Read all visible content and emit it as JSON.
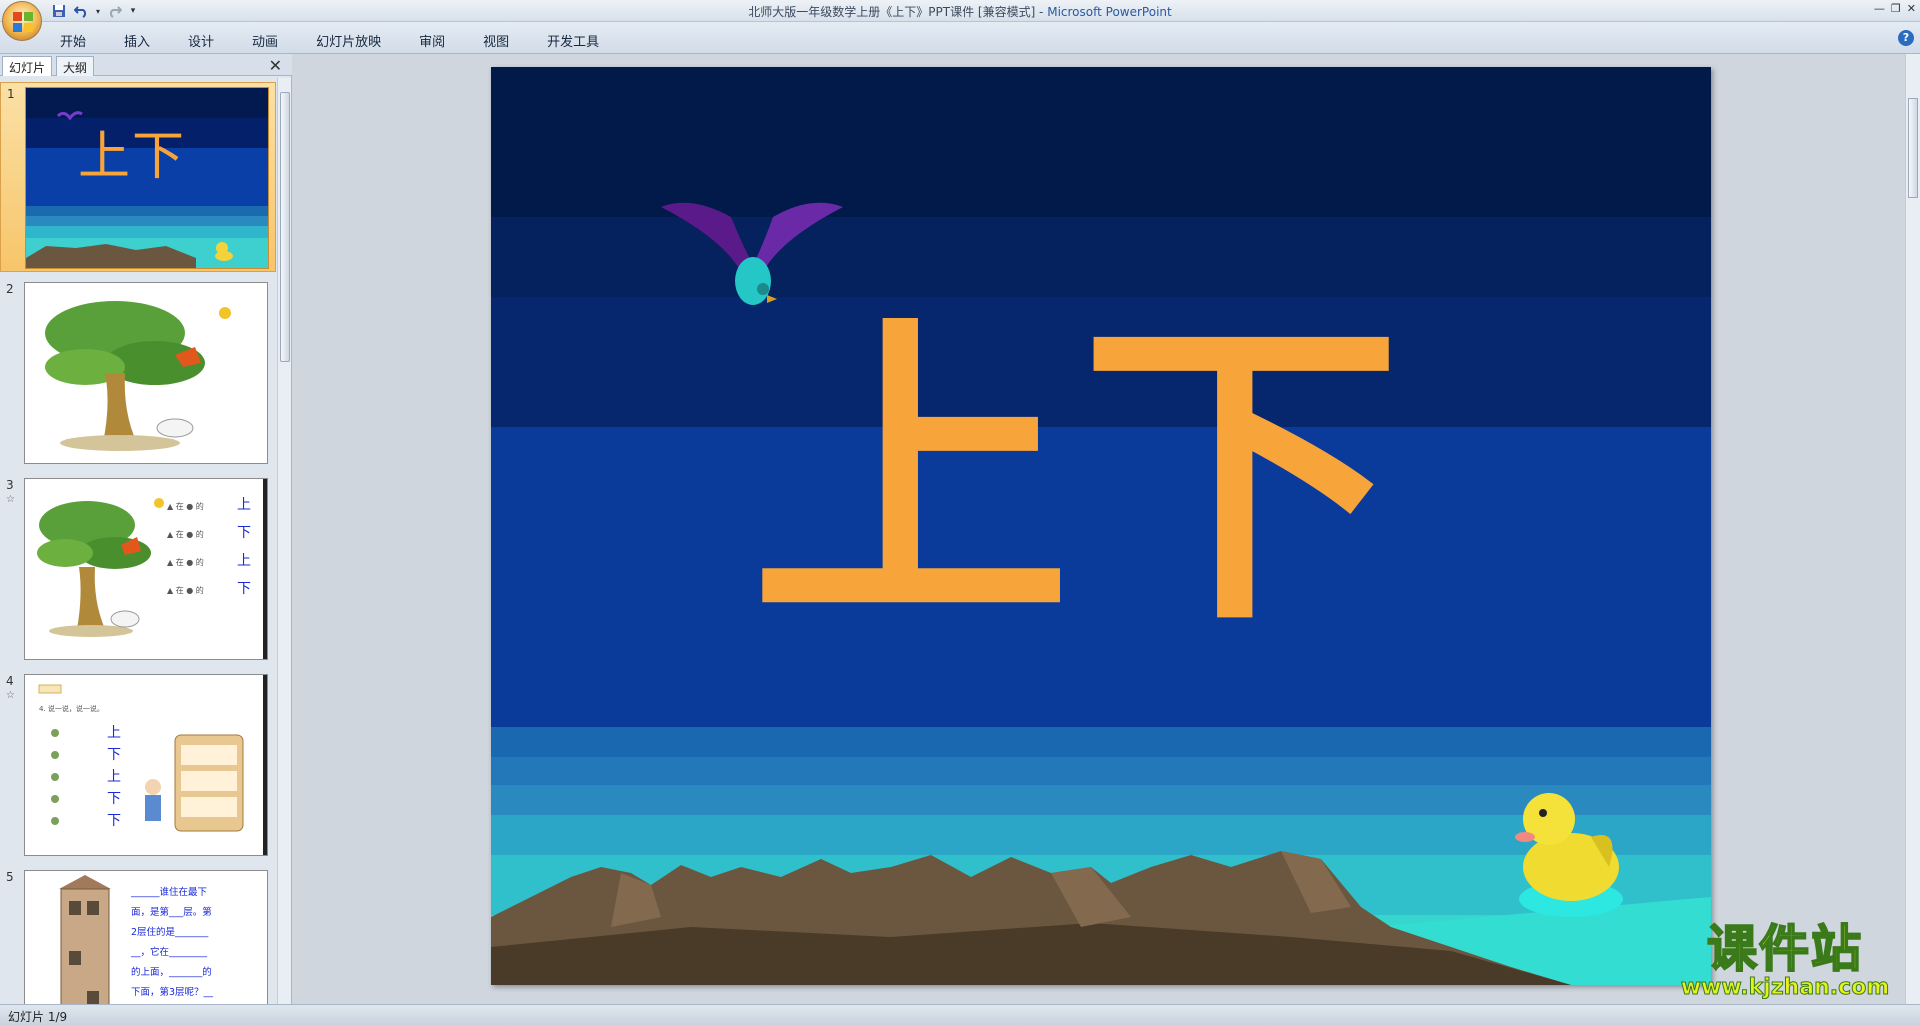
{
  "window": {
    "title": "北师大版一年级数学上册《上下》PPT课件 [兼容模式] - ",
    "app_name": "Microsoft PowerPoint"
  },
  "ribbon": {
    "tabs": [
      "开始",
      "插入",
      "设计",
      "动画",
      "幻灯片放映",
      "审阅",
      "视图",
      "开发工具"
    ]
  },
  "left_pane": {
    "tab_slides": "幻灯片",
    "tab_outline": "大纲",
    "thumbnails": [
      {
        "number": "1",
        "selected": true
      },
      {
        "number": "2"
      },
      {
        "number": "3",
        "star": "☆"
      },
      {
        "number": "4",
        "star": "☆"
      },
      {
        "number": "5"
      }
    ],
    "thumb3_words": [
      "上",
      "下",
      "上",
      "下"
    ],
    "thumb4_header": "4. 说一说，说一说。",
    "thumb4_words": [
      "上",
      "下",
      "上",
      "下",
      "下"
    ],
    "thumb5_lines": [
      "______谁住在最下",
      "面，是第___层。第",
      "2层住的是_______",
      "__，它在________",
      "的上面，_______的",
      "下面，第3层呢？__"
    ]
  },
  "slide": {
    "char_up": "上",
    "char_down": "下"
  },
  "status": {
    "slide_count": "幻灯片 1/9"
  },
  "watermark": {
    "text_zh": "课件站",
    "url": "www.kjzhan.com"
  },
  "colors": {
    "sky_top": "#021a4a",
    "sky_mid": "#0a3a9a",
    "char_orange": "#f7a43a",
    "char_yellow": "#f4d23a",
    "sea_light": "#2fd6cf",
    "mountain": "#6b5740",
    "selected_thumb": "#f7c56a"
  }
}
